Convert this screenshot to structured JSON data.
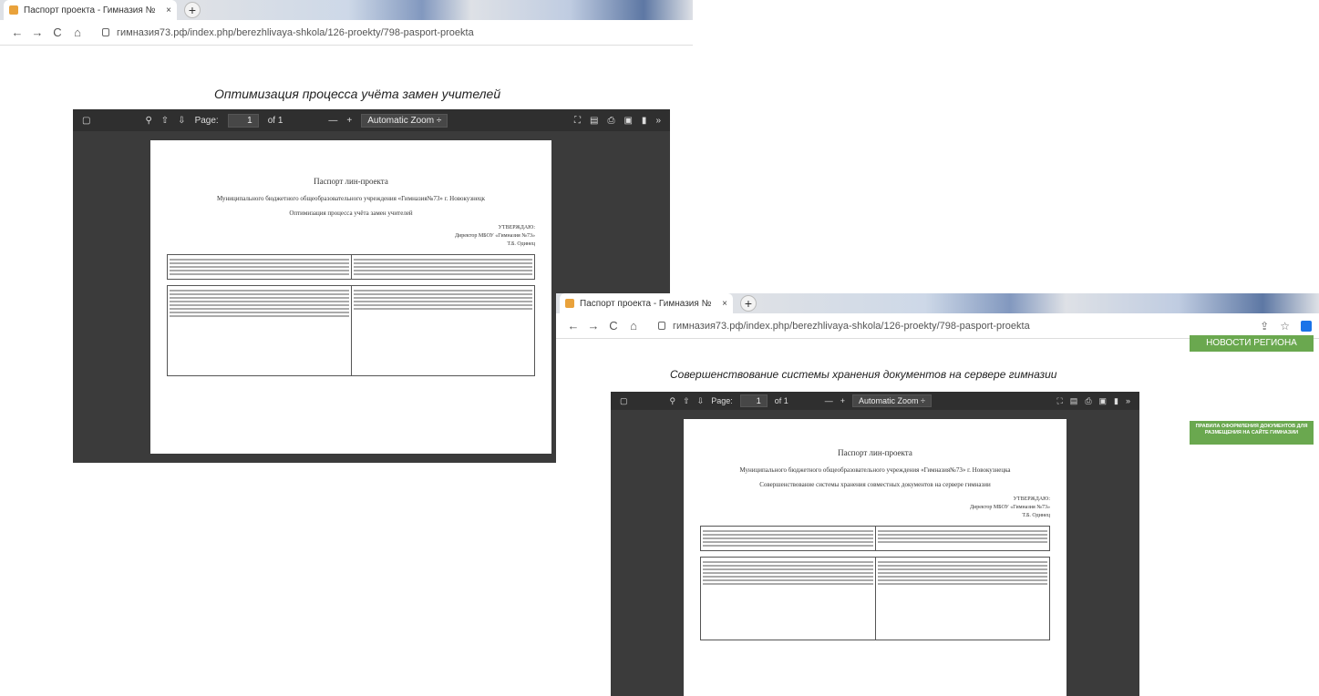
{
  "screenshot1": {
    "tab_title": "Паспорт проекта - Гимназия №",
    "tab_close": "×",
    "newtab": "+",
    "nav": {
      "back": "←",
      "forward": "→",
      "reload": "C",
      "home": "⌂"
    },
    "url": "гимназия73.рф/index.php/berezhlivaya-shkola/126-proekty/798-pasport-proekta",
    "heading": "Оптимизация процесса учёта замен учителей",
    "viewer": {
      "page_label": "Page:",
      "page_value": "1",
      "page_of": "of 1",
      "zoom_minus": "—",
      "zoom_plus": "+",
      "zoom": "Automatic Zoom  ÷",
      "more": "»"
    },
    "doc": {
      "title": "Паспорт лин-проекта",
      "org": "Муниципального бюджетного общеобразовательного учреждения «Гимназия№73» г. Новокузнецк",
      "name": "Оптимизация процесса учёта замен учителей",
      "approve": "УТВЕРЖДАЮ:",
      "director": "Директор МБОУ «Гимназия №73»",
      "director_name": "Т.Б. Одинец"
    }
  },
  "screenshot2": {
    "tab_title": "Паспорт проекта - Гимназия №",
    "tab_close": "×",
    "newtab": "+",
    "nav": {
      "back": "←",
      "forward": "→",
      "reload": "C",
      "home": "⌂"
    },
    "url": "гимназия73.рф/index.php/berezhlivaya-shkola/126-proekty/798-pasport-proekta",
    "heading": "Совершенствование системы хранения документов на сервере гимназии",
    "viewer": {
      "page_label": "Page:",
      "page_value": "1",
      "page_of": "of 1",
      "zoom_minus": "—",
      "zoom_plus": "+",
      "zoom": "Automatic Zoom  ÷",
      "more": "»"
    },
    "doc": {
      "title": "Паспорт лин-проекта",
      "org": "Муниципального бюджетного общеобразовательного учреждения «Гимназия№73» г. Новокузнецка",
      "name": "Совершенствование системы хранения совместных документов на сервере гимназии",
      "approve": "УТВЕРЖДАЮ:",
      "director": "Директор МБОУ «Гимназия №73»",
      "director_name": "Т.Б. Одинец"
    },
    "side_news": "НОВОСТИ РЕГИОНА",
    "side_rules": "ПРАВИЛА ОФОРМЛЕНИЯ ДОКУМЕНТОВ ДЛЯ РАЗМЕЩЕНИЯ НА САЙТЕ ГИМНАЗИИ",
    "colors": {
      "green": "#6aa84f",
      "viewer_bg": "#3b3b3b"
    }
  }
}
